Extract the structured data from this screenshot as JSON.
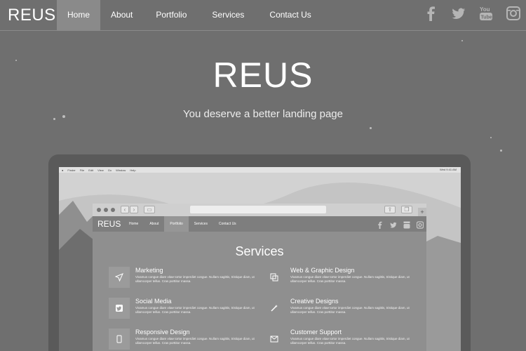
{
  "nav": {
    "logo": "REUS",
    "items": [
      {
        "label": "Home",
        "active": true
      },
      {
        "label": "About",
        "active": false
      },
      {
        "label": "Portfolio",
        "active": false
      },
      {
        "label": "Services",
        "active": false
      },
      {
        "label": "Contact Us",
        "active": false
      }
    ],
    "social": [
      "facebook-icon",
      "twitter-icon",
      "youtube-icon",
      "instagram-icon"
    ]
  },
  "hero": {
    "title": "REUS",
    "subtitle": "You deserve a better landing page"
  },
  "preview": {
    "mac_menu": [
      "Finder",
      "File",
      "Edit",
      "View",
      "Go",
      "Window",
      "Help"
    ],
    "mac_clock": "Wed 9:41 AM",
    "site": {
      "logo": "REUS",
      "items": [
        {
          "label": "Home",
          "active": false
        },
        {
          "label": "About",
          "active": false
        },
        {
          "label": "Portfolio",
          "active": true
        },
        {
          "label": "Services",
          "active": false
        },
        {
          "label": "Contact Us",
          "active": false
        }
      ],
      "section_title": "Services",
      "services": [
        {
          "name": "Marketing",
          "icon": "paper-plane-icon",
          "desc": "Vivamus congue diam vitae tortor imperdiet congue. Nullam sagittis, tristique diam, ut ullamcorper tellus. Cras porttitor massa."
        },
        {
          "name": "Web & Graphic Design",
          "icon": "copy-icon",
          "desc": "Vivamus congue diam vitae tortor imperdiet congue. Nullam sagittis, tristique diam, ut ullamcorper tellus. Cras porttitor massa."
        },
        {
          "name": "Social Media",
          "icon": "twitter-square-icon",
          "desc": "Vivamus congue diam vitae tortor imperdiet congue. Nullam sagittis, tristique diam, ut ullamcorper tellus. Cras porttitor massa."
        },
        {
          "name": "Creative Designs",
          "icon": "magic-wand-icon",
          "desc": "Vivamus congue diam vitae tortor imperdiet congue. Nullam sagittis, tristique diam, ut ullamcorper tellus. Cras porttitor massa."
        },
        {
          "name": "Responsive Design",
          "icon": "mobile-icon",
          "desc": "Vivamus congue diam vitae tortor imperdiet congue. Nullam sagittis, tristique diam, ut ullamcorper tellus. Cras porttitor massa."
        },
        {
          "name": "Customer Support",
          "icon": "envelope-icon",
          "desc": "Vivamus congue diam vitae tortor imperdiet congue. Nullam sagittis, tristique diam, ut ullamcorper tellus. Cras porttitor massa."
        }
      ]
    }
  },
  "colors": {
    "background": "#6f6f6f",
    "nav_active": "#8a8a8a",
    "text": "#ffffff"
  }
}
